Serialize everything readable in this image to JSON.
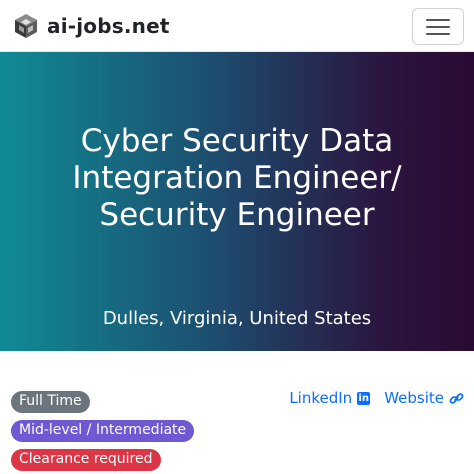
{
  "header": {
    "brand": "ai-jobs.net",
    "icons": {
      "logo": "cube-logo-icon",
      "menu": "hamburger-menu-icon"
    }
  },
  "job": {
    "title": "Cyber Security Data Integration Engineer/ Security Engineer",
    "location": "Dulles, Virginia, United States",
    "badges": {
      "employment_type": "Full Time",
      "level": "Mid-level / Intermediate",
      "clearance": "Clearance required"
    },
    "links": {
      "linkedin": "LinkedIn",
      "website": "Website"
    }
  },
  "colors": {
    "gradient_start": "#0f8b94",
    "gradient_end": "#2a0a32",
    "badge_gray": "#6c757d",
    "badge_purple": "#6f58d2",
    "badge_red": "#dc3545",
    "link_blue": "#0d6efd"
  }
}
